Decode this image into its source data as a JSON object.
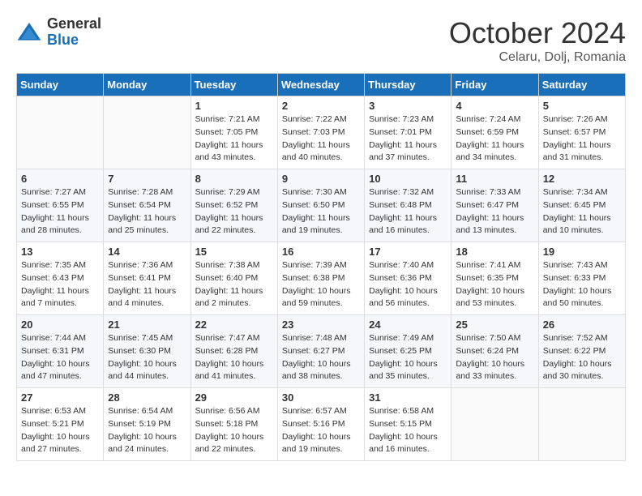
{
  "header": {
    "logo_general": "General",
    "logo_blue": "Blue",
    "month_title": "October 2024",
    "location": "Celaru, Dolj, Romania"
  },
  "days_of_week": [
    "Sunday",
    "Monday",
    "Tuesday",
    "Wednesday",
    "Thursday",
    "Friday",
    "Saturday"
  ],
  "weeks": [
    [
      {
        "day": "",
        "info": ""
      },
      {
        "day": "",
        "info": ""
      },
      {
        "day": "1",
        "info": "Sunrise: 7:21 AM\nSunset: 7:05 PM\nDaylight: 11 hours and 43 minutes."
      },
      {
        "day": "2",
        "info": "Sunrise: 7:22 AM\nSunset: 7:03 PM\nDaylight: 11 hours and 40 minutes."
      },
      {
        "day": "3",
        "info": "Sunrise: 7:23 AM\nSunset: 7:01 PM\nDaylight: 11 hours and 37 minutes."
      },
      {
        "day": "4",
        "info": "Sunrise: 7:24 AM\nSunset: 6:59 PM\nDaylight: 11 hours and 34 minutes."
      },
      {
        "day": "5",
        "info": "Sunrise: 7:26 AM\nSunset: 6:57 PM\nDaylight: 11 hours and 31 minutes."
      }
    ],
    [
      {
        "day": "6",
        "info": "Sunrise: 7:27 AM\nSunset: 6:55 PM\nDaylight: 11 hours and 28 minutes."
      },
      {
        "day": "7",
        "info": "Sunrise: 7:28 AM\nSunset: 6:54 PM\nDaylight: 11 hours and 25 minutes."
      },
      {
        "day": "8",
        "info": "Sunrise: 7:29 AM\nSunset: 6:52 PM\nDaylight: 11 hours and 22 minutes."
      },
      {
        "day": "9",
        "info": "Sunrise: 7:30 AM\nSunset: 6:50 PM\nDaylight: 11 hours and 19 minutes."
      },
      {
        "day": "10",
        "info": "Sunrise: 7:32 AM\nSunset: 6:48 PM\nDaylight: 11 hours and 16 minutes."
      },
      {
        "day": "11",
        "info": "Sunrise: 7:33 AM\nSunset: 6:47 PM\nDaylight: 11 hours and 13 minutes."
      },
      {
        "day": "12",
        "info": "Sunrise: 7:34 AM\nSunset: 6:45 PM\nDaylight: 11 hours and 10 minutes."
      }
    ],
    [
      {
        "day": "13",
        "info": "Sunrise: 7:35 AM\nSunset: 6:43 PM\nDaylight: 11 hours and 7 minutes."
      },
      {
        "day": "14",
        "info": "Sunrise: 7:36 AM\nSunset: 6:41 PM\nDaylight: 11 hours and 4 minutes."
      },
      {
        "day": "15",
        "info": "Sunrise: 7:38 AM\nSunset: 6:40 PM\nDaylight: 11 hours and 2 minutes."
      },
      {
        "day": "16",
        "info": "Sunrise: 7:39 AM\nSunset: 6:38 PM\nDaylight: 10 hours and 59 minutes."
      },
      {
        "day": "17",
        "info": "Sunrise: 7:40 AM\nSunset: 6:36 PM\nDaylight: 10 hours and 56 minutes."
      },
      {
        "day": "18",
        "info": "Sunrise: 7:41 AM\nSunset: 6:35 PM\nDaylight: 10 hours and 53 minutes."
      },
      {
        "day": "19",
        "info": "Sunrise: 7:43 AM\nSunset: 6:33 PM\nDaylight: 10 hours and 50 minutes."
      }
    ],
    [
      {
        "day": "20",
        "info": "Sunrise: 7:44 AM\nSunset: 6:31 PM\nDaylight: 10 hours and 47 minutes."
      },
      {
        "day": "21",
        "info": "Sunrise: 7:45 AM\nSunset: 6:30 PM\nDaylight: 10 hours and 44 minutes."
      },
      {
        "day": "22",
        "info": "Sunrise: 7:47 AM\nSunset: 6:28 PM\nDaylight: 10 hours and 41 minutes."
      },
      {
        "day": "23",
        "info": "Sunrise: 7:48 AM\nSunset: 6:27 PM\nDaylight: 10 hours and 38 minutes."
      },
      {
        "day": "24",
        "info": "Sunrise: 7:49 AM\nSunset: 6:25 PM\nDaylight: 10 hours and 35 minutes."
      },
      {
        "day": "25",
        "info": "Sunrise: 7:50 AM\nSunset: 6:24 PM\nDaylight: 10 hours and 33 minutes."
      },
      {
        "day": "26",
        "info": "Sunrise: 7:52 AM\nSunset: 6:22 PM\nDaylight: 10 hours and 30 minutes."
      }
    ],
    [
      {
        "day": "27",
        "info": "Sunrise: 6:53 AM\nSunset: 5:21 PM\nDaylight: 10 hours and 27 minutes."
      },
      {
        "day": "28",
        "info": "Sunrise: 6:54 AM\nSunset: 5:19 PM\nDaylight: 10 hours and 24 minutes."
      },
      {
        "day": "29",
        "info": "Sunrise: 6:56 AM\nSunset: 5:18 PM\nDaylight: 10 hours and 22 minutes."
      },
      {
        "day": "30",
        "info": "Sunrise: 6:57 AM\nSunset: 5:16 PM\nDaylight: 10 hours and 19 minutes."
      },
      {
        "day": "31",
        "info": "Sunrise: 6:58 AM\nSunset: 5:15 PM\nDaylight: 10 hours and 16 minutes."
      },
      {
        "day": "",
        "info": ""
      },
      {
        "day": "",
        "info": ""
      }
    ]
  ]
}
